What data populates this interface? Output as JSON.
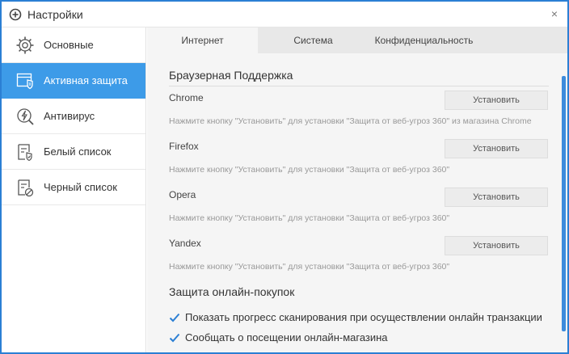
{
  "window": {
    "title": "Настройки",
    "close_symbol": "×",
    "title_icon": "plus-circle-icon",
    "accent_color": "#3d9be8",
    "border_color": "#2b7fd4"
  },
  "sidebar": {
    "items": [
      {
        "label": "Основные",
        "icon": "gear-icon",
        "active": false
      },
      {
        "label": "Активная защита",
        "icon": "shield-window-icon",
        "active": true
      },
      {
        "label": "Антивирус",
        "icon": "lightning-search-icon",
        "active": false
      },
      {
        "label": "Белый список",
        "icon": "whitelist-shield-icon",
        "active": false
      },
      {
        "label": "Черный список",
        "icon": "blacklist-block-icon",
        "active": false
      }
    ]
  },
  "tabs": [
    {
      "label": "Интернет",
      "active": true
    },
    {
      "label": "Система",
      "active": false
    },
    {
      "label": "Конфиденциальность",
      "active": false
    }
  ],
  "browser_support": {
    "title": "Браузерная Поддержка",
    "install_label": "Установить",
    "browsers": [
      {
        "name": "Chrome",
        "description": "Нажмите кнопку \"Установить\" для установки \"Защита от веб-угроз 360\" из магазина Chrome"
      },
      {
        "name": "Firefox",
        "description": "Нажмите кнопку \"Установить\" для установки \"Защита от веб-угроз 360\""
      },
      {
        "name": "Opera",
        "description": "Нажмите кнопку \"Установить\" для установки \"Защита от веб-угроз 360\""
      },
      {
        "name": "Yandex",
        "description": "Нажмите кнопку \"Установить\" для установки \"Защита от веб-угроз 360\""
      }
    ]
  },
  "online_shopping": {
    "title": "Защита онлайн-покупок",
    "options": [
      {
        "label": "Показать прогресс сканирования при осуществлении онлайн транзакции",
        "checked": true
      },
      {
        "label": "Сообщать о посещении онлайн-магазина",
        "checked": true
      }
    ]
  }
}
